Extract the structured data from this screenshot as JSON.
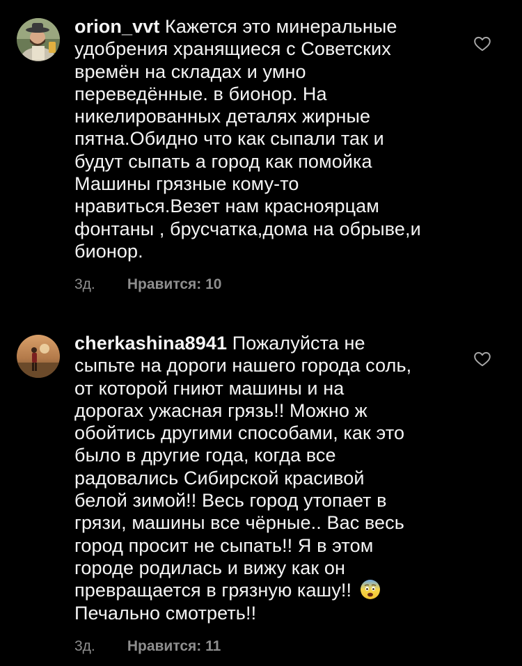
{
  "comments": [
    {
      "username": "orion_vvt",
      "text": "Кажется это минеральные\nудобрения хранящиеся с Советских\nвремён на складах и умно\nпереведённые. в бионор. На\nникелированных деталях жирные\nпятна.Обидно что как сыпали так и\nбудут сыпать а город как помойка\nМашины грязные кому-то\nнравиться.Везет нам красноярцам\nфонтаны , брусчатка,дома на обрыве,и\nбионор.",
      "time": "3д.",
      "likes": "Нравится: 10",
      "avatar_icon": "man-with-hat-avatar",
      "like_icon": "heart-outline-icon"
    },
    {
      "username": "cherkashina8941",
      "text": "Пожалуйста не\nсыпьте на дороги нашего города соль,\nот которой гниют машины и на\nдорогах ужасная грязь!! Можно ж\nобойтись другими способами, как это\nбыло в другие года, когда все\nрадовались Сибирской красивой\nбелой зимой!! Весь город утопает в\nгрязи, машины все чёрные.. Вас весь\nгород просит не сыпать!! Я в этом\nгороде родилась и вижу как он\nпревращается в грязную кашу!!",
      "text_tail": "\nПечально смотреть!!",
      "emoji": "fearful-face-emoji",
      "time": "3д.",
      "likes": "Нравится: 11",
      "avatar_icon": "person-in-field-avatar",
      "like_icon": "heart-outline-icon"
    }
  ],
  "colors": {
    "background": "#000000",
    "text": "#f5f5f5",
    "meta": "#8e8e8e"
  }
}
